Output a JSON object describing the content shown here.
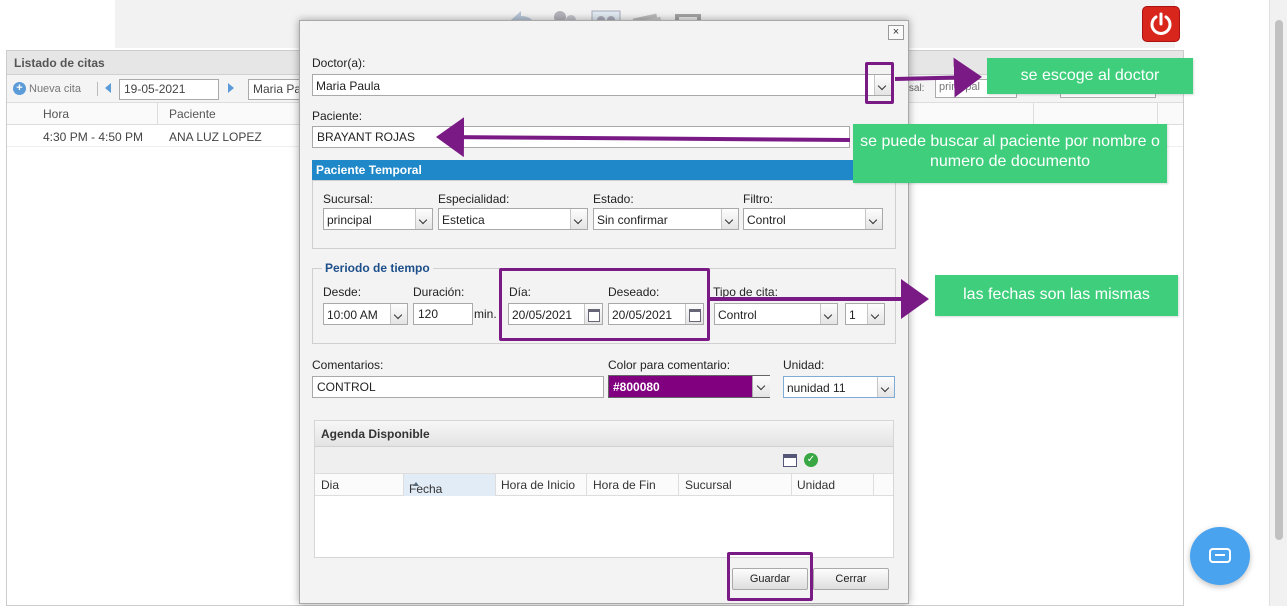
{
  "list": {
    "title": "Listado de citas",
    "new_label": "Nueva cita",
    "date": "19-05-2021",
    "doctor_short": "Maria Pa",
    "sucursal_label": "ursal:",
    "sucursal_value": "principal",
    "columns": [
      "Hora",
      "Paciente"
    ],
    "rows": [
      {
        "hora": "4:30 PM - 4:50 PM",
        "paciente": "ANA LUZ LOPEZ"
      }
    ]
  },
  "dialog": {
    "close": "×",
    "doctor_label": "Doctor(a):",
    "doctor_value": "Maria Paula",
    "patient_label": "Paciente:",
    "patient_value": "BRAYANT  ROJAS",
    "temp_bar": "Paciente Temporal",
    "sucursal_label": "Sucursal:",
    "sucursal_value": "principal",
    "especialidad_label": "Especialidad:",
    "especialidad_value": "Estetica",
    "estado_label": "Estado:",
    "estado_value": "Sin confirmar",
    "filtro_label": "Filtro:",
    "filtro_value": "Control",
    "periodo_legend": "Periodo de tiempo",
    "desde_label": "Desde:",
    "desde_value": "10:00 AM",
    "duracion_label": "Duración:",
    "duracion_value": "120",
    "min_label": "min.",
    "dia_label": "Día:",
    "dia_value": "20/05/2021",
    "deseado_label": "Deseado:",
    "deseado_value": "20/05/2021",
    "tipo_label": "Tipo de cita:",
    "tipo_value": "Control",
    "tipo_num": "1",
    "comentarios_label": "Comentarios:",
    "comentarios_value": "CONTROL",
    "color_label": "Color para comentario:",
    "color_value": "#800080",
    "unidad_label": "Unidad:",
    "unidad_value": "nunidad 11",
    "agenda_title": "Agenda Disponible",
    "agenda_columns": [
      "Dia",
      "Fecha",
      "Hora de Inicio",
      "Hora de Fin",
      "Sucursal",
      "Unidad"
    ],
    "save": "Guardar",
    "cancel": "Cerrar"
  },
  "callouts": {
    "doctor": "se escoge al doctor",
    "patient": "se puede buscar al paciente por nombre o numero de documento",
    "dates": "las fechas son las mismas"
  },
  "colors": {
    "accent_blue": "#1f88c8",
    "highlight": "#7a1b85",
    "callout_green": "#3fcf7c",
    "comment_color": "#800080"
  },
  "icons": [
    "undo-icon",
    "users-icon",
    "contacts-icon",
    "cards-icon",
    "scanner-icon",
    "power-icon",
    "plus-icon",
    "calendar-icon",
    "check-icon",
    "chat-icon"
  ]
}
